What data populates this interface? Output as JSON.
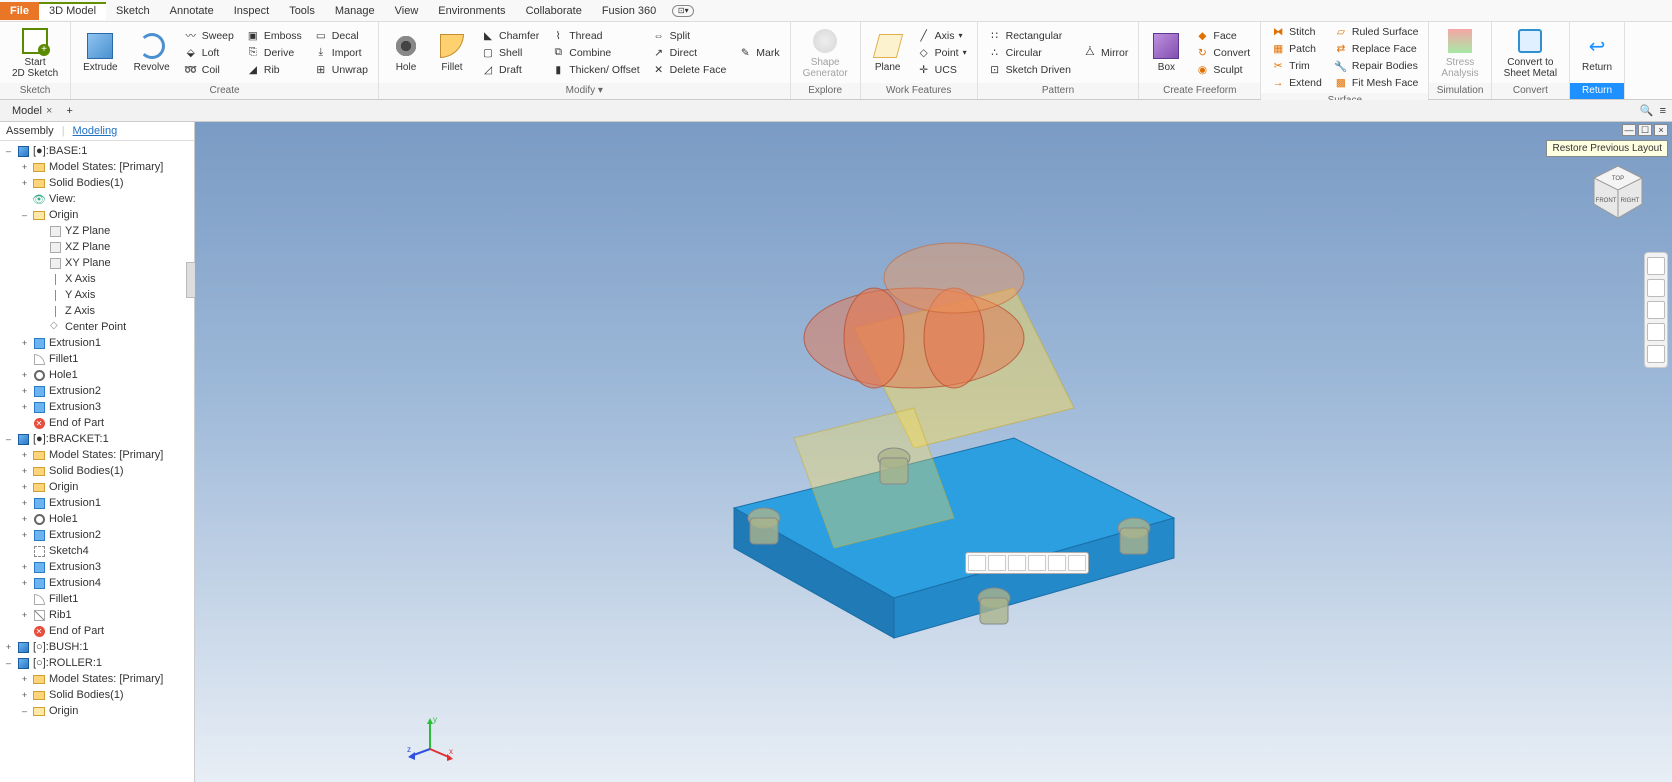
{
  "menus": {
    "file": "File",
    "items": [
      "3D Model",
      "Sketch",
      "Annotate",
      "Inspect",
      "Tools",
      "Manage",
      "View",
      "Environments",
      "Collaborate",
      "Fusion 360"
    ],
    "active": "3D Model"
  },
  "ribbon": {
    "sketch": {
      "label": "Sketch",
      "start": "Start\n2D Sketch"
    },
    "create": {
      "label": "Create",
      "extrude": "Extrude",
      "revolve": "Revolve",
      "col1": [
        "Sweep",
        "Loft",
        "Coil"
      ],
      "col2": [
        "Emboss",
        "Derive",
        "Rib"
      ],
      "col3": [
        "Decal",
        "Import",
        "Unwrap"
      ]
    },
    "modify": {
      "label": "Modify ▾",
      "hole": "Hole",
      "fillet": "Fillet",
      "col1": [
        "Chamfer",
        "Shell",
        "Draft"
      ],
      "col2": [
        "Thread",
        "Combine",
        "Thicken/ Offset"
      ],
      "col3": [
        "Split",
        "Direct",
        "Delete Face"
      ],
      "mark": "Mark"
    },
    "explore": {
      "label": "Explore",
      "shape": "Shape\nGenerator"
    },
    "workfeat": {
      "label": "Work Features",
      "plane": "Plane",
      "items": [
        "Axis",
        "Point",
        "UCS"
      ]
    },
    "pattern": {
      "label": "Pattern",
      "col1": [
        "Rectangular",
        "Circular",
        "Sketch Driven"
      ],
      "mirror": "Mirror"
    },
    "freeform": {
      "label": "Create Freeform",
      "box": "Box",
      "items": [
        "Face",
        "Convert",
        "Sculpt"
      ]
    },
    "surface": {
      "label": "Surface",
      "col1": [
        "Stitch",
        "Patch",
        "Trim",
        "Extend"
      ],
      "col2": [
        "Ruled Surface",
        "Replace Face",
        "Repair Bodies",
        "Fit Mesh Face"
      ]
    },
    "simulation": {
      "label": "Simulation",
      "stress": "Stress\nAnalysis"
    },
    "convert": {
      "label": "Convert",
      "sheet": "Convert to\nSheet Metal"
    },
    "return": {
      "label": "Return",
      "ret": "Return"
    }
  },
  "doctab": {
    "name": "Model",
    "search_ph": ""
  },
  "browser": {
    "tabs": [
      "Assembly",
      "Modeling"
    ],
    "active": "Modeling",
    "tree": [
      {
        "d": 0,
        "exp": "–",
        "ic": "cube",
        "t": "[●]:BASE:1"
      },
      {
        "d": 1,
        "exp": "+",
        "ic": "folder",
        "t": "Model States: [Primary]"
      },
      {
        "d": 1,
        "exp": "+",
        "ic": "folder",
        "t": "Solid Bodies(1)"
      },
      {
        "d": 1,
        "exp": "",
        "ic": "view",
        "t": "View:"
      },
      {
        "d": 1,
        "exp": "–",
        "ic": "folderopen",
        "t": "Origin"
      },
      {
        "d": 2,
        "exp": "",
        "ic": "plane",
        "t": "YZ Plane"
      },
      {
        "d": 2,
        "exp": "",
        "ic": "plane",
        "t": "XZ Plane"
      },
      {
        "d": 2,
        "exp": "",
        "ic": "plane",
        "t": "XY Plane"
      },
      {
        "d": 2,
        "exp": "",
        "ic": "axis",
        "t": "X Axis"
      },
      {
        "d": 2,
        "exp": "",
        "ic": "axis",
        "t": "Y Axis"
      },
      {
        "d": 2,
        "exp": "",
        "ic": "axis",
        "t": "Z Axis"
      },
      {
        "d": 2,
        "exp": "",
        "ic": "pt",
        "t": "Center Point"
      },
      {
        "d": 1,
        "exp": "+",
        "ic": "ext",
        "t": "Extrusion1"
      },
      {
        "d": 1,
        "exp": "",
        "ic": "fillet",
        "t": "Fillet1"
      },
      {
        "d": 1,
        "exp": "+",
        "ic": "hole",
        "t": "Hole1"
      },
      {
        "d": 1,
        "exp": "+",
        "ic": "ext",
        "t": "Extrusion2"
      },
      {
        "d": 1,
        "exp": "+",
        "ic": "ext",
        "t": "Extrusion3"
      },
      {
        "d": 1,
        "exp": "",
        "ic": "end",
        "t": "End of Part"
      },
      {
        "d": 0,
        "exp": "–",
        "ic": "cube",
        "t": "[●]:BRACKET:1"
      },
      {
        "d": 1,
        "exp": "+",
        "ic": "folder",
        "t": "Model States: [Primary]"
      },
      {
        "d": 1,
        "exp": "+",
        "ic": "folder",
        "t": "Solid Bodies(1)"
      },
      {
        "d": 1,
        "exp": "+",
        "ic": "folder",
        "t": "Origin"
      },
      {
        "d": 1,
        "exp": "+",
        "ic": "ext",
        "t": "Extrusion1"
      },
      {
        "d": 1,
        "exp": "+",
        "ic": "hole",
        "t": "Hole1"
      },
      {
        "d": 1,
        "exp": "+",
        "ic": "ext",
        "t": "Extrusion2"
      },
      {
        "d": 1,
        "exp": "",
        "ic": "sketch",
        "t": "Sketch4"
      },
      {
        "d": 1,
        "exp": "+",
        "ic": "ext",
        "t": "Extrusion3"
      },
      {
        "d": 1,
        "exp": "+",
        "ic": "ext",
        "t": "Extrusion4"
      },
      {
        "d": 1,
        "exp": "",
        "ic": "fillet",
        "t": "Fillet1"
      },
      {
        "d": 1,
        "exp": "+",
        "ic": "rib",
        "t": "Rib1"
      },
      {
        "d": 1,
        "exp": "",
        "ic": "end",
        "t": "End of Part"
      },
      {
        "d": 0,
        "exp": "+",
        "ic": "cube",
        "t": "[○]:BUSH:1"
      },
      {
        "d": 0,
        "exp": "–",
        "ic": "cube",
        "t": "[○]:ROLLER:1"
      },
      {
        "d": 1,
        "exp": "+",
        "ic": "folder",
        "t": "Model States: [Primary]"
      },
      {
        "d": 1,
        "exp": "+",
        "ic": "folder",
        "t": "Solid Bodies(1)"
      },
      {
        "d": 1,
        "exp": "–",
        "ic": "folderopen",
        "t": "Origin"
      }
    ]
  },
  "tooltip": "Restore Previous Layout",
  "viewcube": {
    "top": "TOP",
    "front": "FRONT",
    "right": "RIGHT"
  },
  "triad": {
    "x": "x",
    "y": "y",
    "z": "z"
  }
}
